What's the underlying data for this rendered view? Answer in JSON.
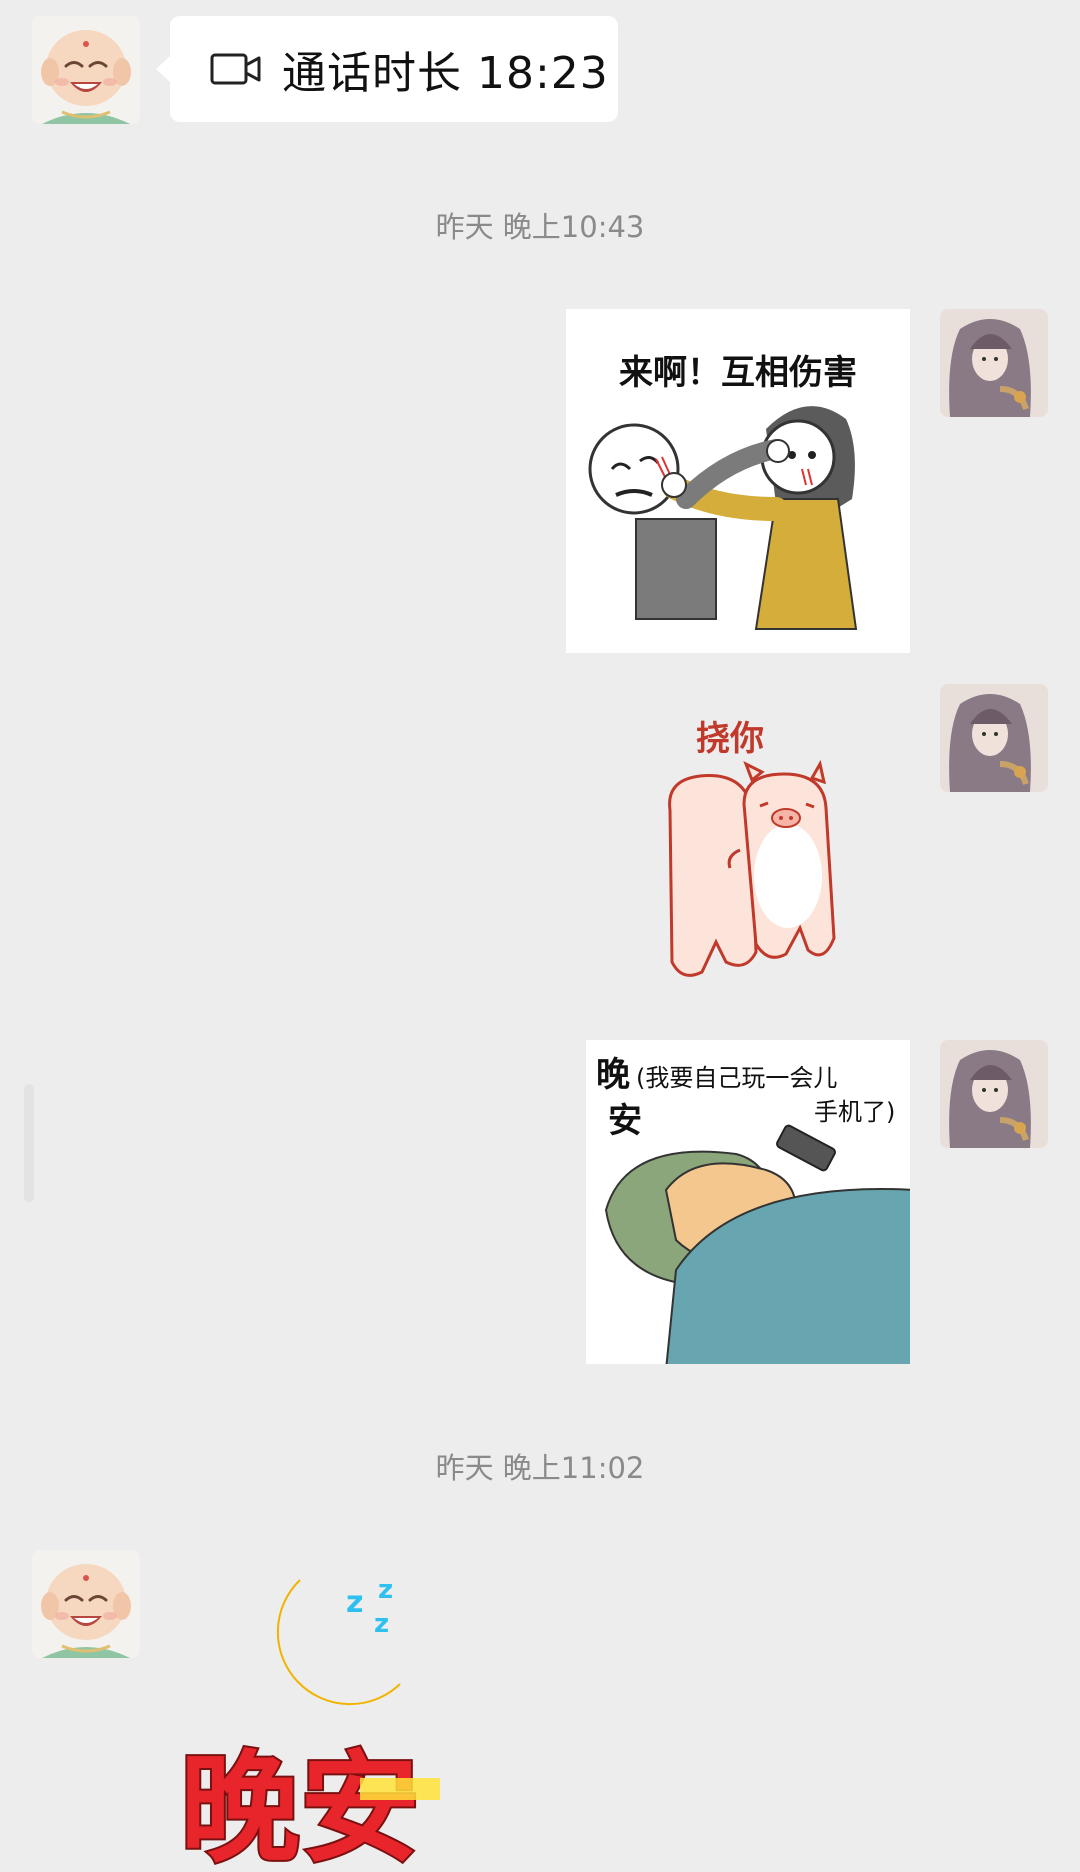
{
  "messages": {
    "call": {
      "icon": "video-camera-icon",
      "text": "通话时长 18:23"
    },
    "timestamp_1": "昨天 晚上10:43",
    "sticker_fight": {
      "caption": "来啊！互相伤害"
    },
    "sticker_pigs": {
      "caption": "挠你"
    },
    "sticker_sleep": {
      "caption_line1": "晚",
      "caption_line1b": "(我要自己玩一会儿",
      "caption_line2": "安",
      "caption_line2b": "手机了)"
    },
    "timestamp_2": "昨天 晚上11:02",
    "sticker_goodnight": {
      "text": "晚安",
      "zzz": "z"
    }
  },
  "colors": {
    "background": "#ededed",
    "bubble": "#ffffff",
    "timestamp": "#8a8a8a",
    "moon": "#ffd21f",
    "goodnight_red": "#e8252b",
    "goodnight_yellow": "#ffe23a",
    "zzz": "#2ec0ef"
  }
}
